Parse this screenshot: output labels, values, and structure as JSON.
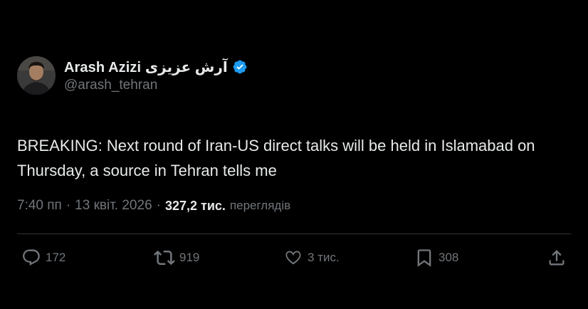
{
  "author": {
    "display_name": "Arash Azizi آرش عزیزی",
    "handle": "@arash_tehran"
  },
  "tweet": {
    "text": "BREAKING: Next round of Iran-US direct talks will be held in Islamabad on Thursday, a source in Tehran tells me",
    "time": "7:40 пп",
    "separator": "·",
    "date": "13 квіт. 2026",
    "views_count": "327,2 тис.",
    "views_label": "переглядів"
  },
  "actions": {
    "replies": "172",
    "reposts": "919",
    "likes": "3 тис.",
    "bookmarks": "308"
  },
  "colors": {
    "background": "#000000",
    "text_primary": "#e7e9ea",
    "text_secondary": "#71767b",
    "verified_badge": "#1d9bf0",
    "divider": "#2f3336"
  },
  "icons": [
    "verified-badge-icon",
    "reply-icon",
    "retweet-icon",
    "like-icon",
    "bookmark-icon",
    "share-icon"
  ]
}
